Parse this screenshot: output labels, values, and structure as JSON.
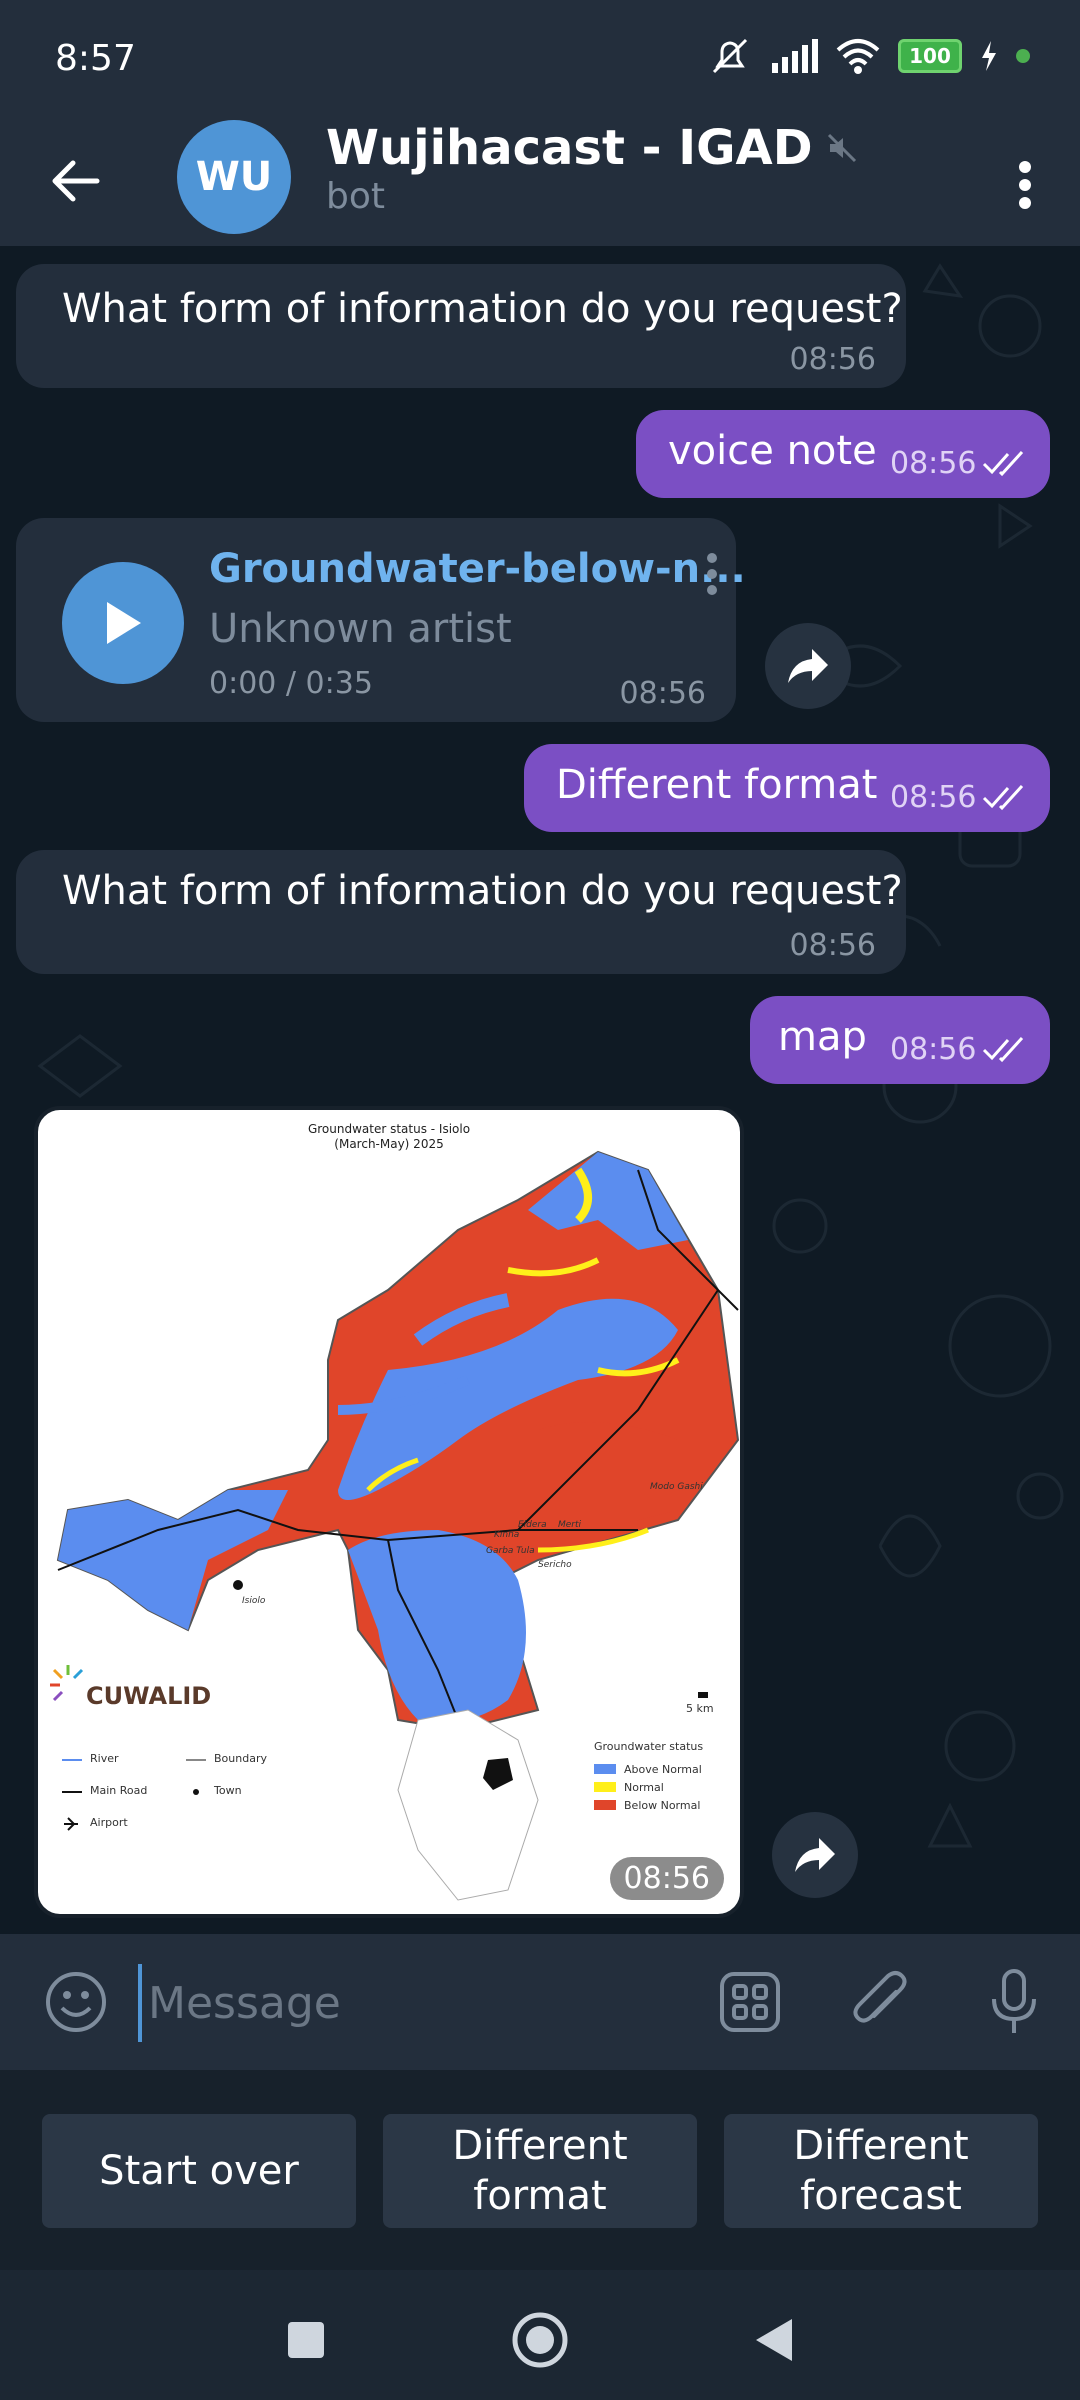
{
  "status_bar": {
    "time": "8:57",
    "battery": "100"
  },
  "header": {
    "avatar_initials": "WU",
    "title": "Wujihacast - IGAD",
    "subtitle": "bot"
  },
  "messages": [
    {
      "text": "What form of information do you request?",
      "time": "08:56"
    },
    {
      "text": "voice note",
      "time": "08:56"
    },
    {
      "audio_title": "Groundwater-below-n...",
      "audio_artist": "Unknown artist",
      "audio_duration": "0:00 / 0:35",
      "time": "08:56"
    },
    {
      "text": "Different format",
      "time": "08:56"
    },
    {
      "text": "What form of information do you request?",
      "time": "08:56"
    },
    {
      "text": "map",
      "time": "08:56"
    },
    {
      "time": "08:56"
    }
  ],
  "map": {
    "title_line1": "Groundwater status - Isiolo",
    "title_line2": "(March-May) 2025",
    "logo": "CUWALID",
    "legend_title": "Groundwater status",
    "legend": [
      {
        "label": "Above Normal",
        "color": "#5b8def"
      },
      {
        "label": "Normal",
        "color": "#ffef1a"
      },
      {
        "label": "Below Normal",
        "color": "#e0452a"
      }
    ],
    "features": [
      "River",
      "Main Road",
      "Airport",
      "Boundary",
      "Town"
    ],
    "scale": "5 km",
    "places": [
      "Isiolo",
      "Modo Gashi",
      "Garba Tula",
      "Kinna",
      "Merti",
      "Eldera",
      "Sericho"
    ]
  },
  "input": {
    "placeholder": "Message"
  },
  "keyboard": [
    "Start over",
    "Different\nformat",
    "Different\nforecast"
  ],
  "colors": {
    "accent": "#4f95d6",
    "outgoing": "#7b4fc4",
    "incoming": "#232e3c",
    "background": "#17212b"
  }
}
